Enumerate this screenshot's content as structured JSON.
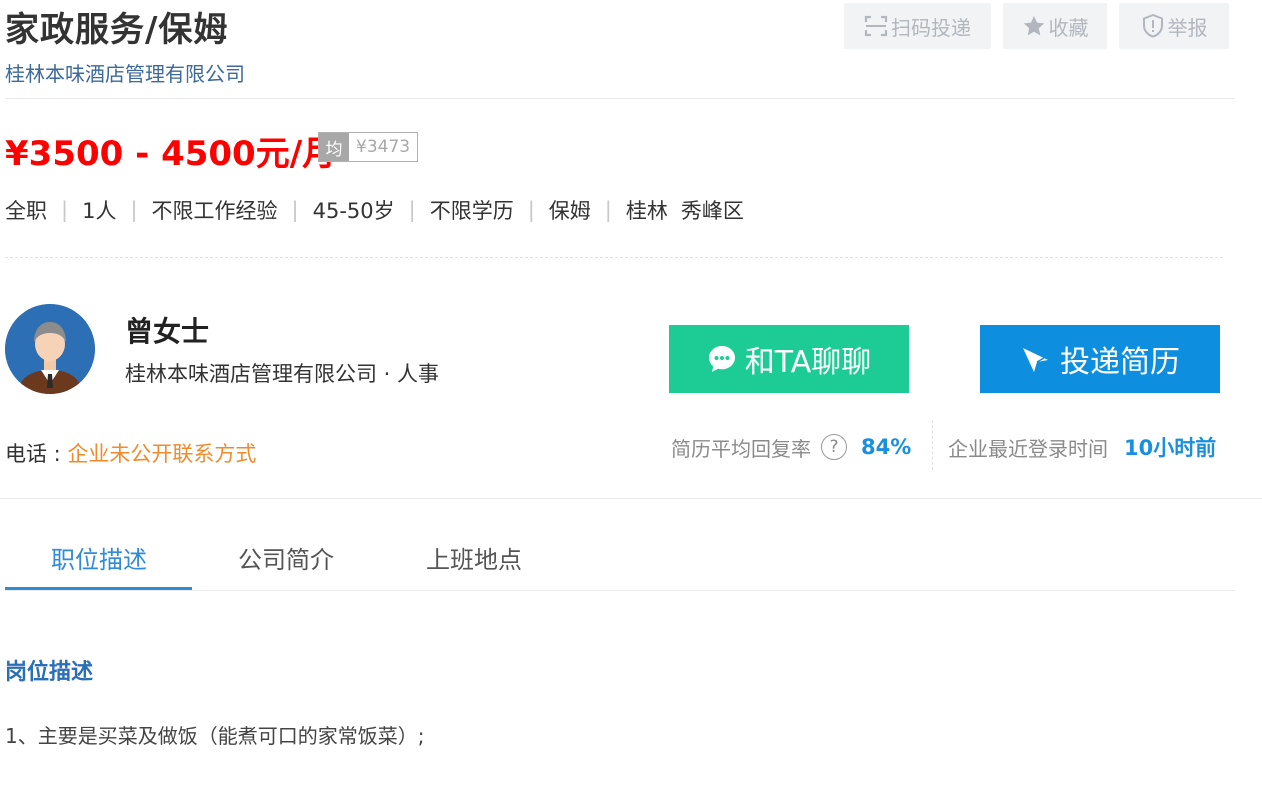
{
  "header": {
    "title": "家政服务/保姆",
    "company": "桂林本味酒店管理有限公司",
    "actions": {
      "scan_apply": "扫码投递",
      "favorite": "收藏",
      "report": "举报"
    }
  },
  "salary": {
    "range": "¥3500 - 4500元/月",
    "avg_label": "均",
    "avg_value": "¥3473"
  },
  "tags": {
    "type": "全职",
    "headcount": "1人",
    "experience": "不限工作经验",
    "age": "45-50岁",
    "education": "不限学历",
    "category": "保姆",
    "city": "桂林",
    "district": "秀峰区"
  },
  "recruiter": {
    "name": "曾女士",
    "company_role": "桂林本味酒店管理有限公司 · 人事",
    "chat_button": "和TA聊聊",
    "apply_button": "投递简历"
  },
  "contact": {
    "label": "电话 : ",
    "value": "企业未公开联系方式"
  },
  "stats": {
    "reply_rate_label": "简历平均回复率",
    "help_icon_text": "?",
    "reply_rate_value": "84%",
    "last_login_label": "企业最近登录时间",
    "last_login_value": "10小时前"
  },
  "tabs": [
    {
      "label": "职位描述",
      "active": true
    },
    {
      "label": "公司简介",
      "active": false
    },
    {
      "label": "上班地点",
      "active": false
    }
  ],
  "description": {
    "heading": "岗位描述",
    "lines": [
      "1、主要是买菜及做饭（能煮可口的家常饭菜）;"
    ]
  },
  "colors": {
    "salary": "#ff0000",
    "chat_button": "#1dcc95",
    "apply_button": "#0d8ede",
    "accent_blue": "#2f8ad8",
    "phone_orange": "#f08b2c"
  },
  "icons": {
    "scan": "scan-icon",
    "favorite": "star-icon",
    "report": "shield-icon",
    "chat": "chat-bubble-icon",
    "apply": "send-arrow-icon",
    "help": "question-circle-icon"
  }
}
